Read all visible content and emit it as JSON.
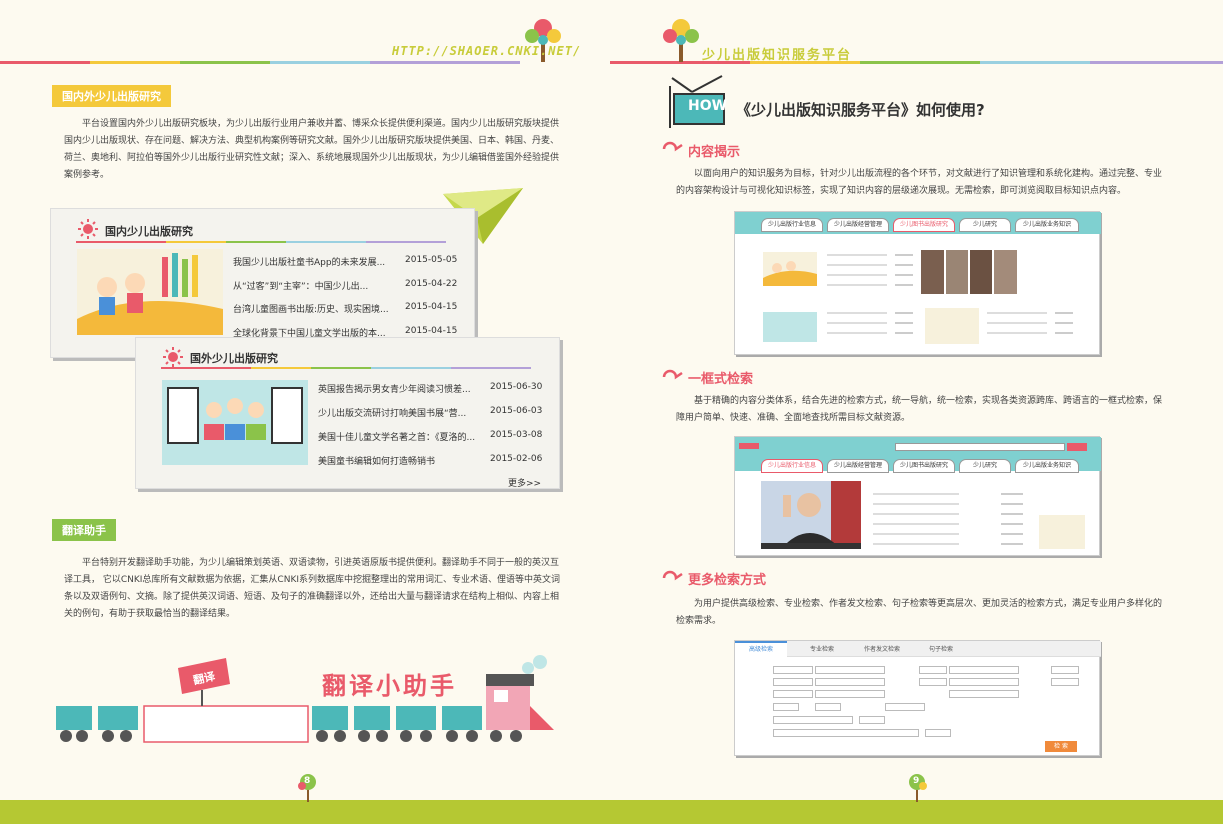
{
  "header": {
    "url": "HTTP://SHAOER.CNKI.NET/",
    "brand": "少儿出版知识服务平台"
  },
  "left": {
    "section1": {
      "label": "国内外少儿出版研究",
      "paragraph": "平台设置国内外少儿出版研究板块，为少儿出版行业用户兼收并蓄、博采众长提供便利渠道。国内少儿出版研究版块提供国内少儿出版现状、存在问题、解决方法、典型机构案例等研究文献。国外少儿出版研究版块提供美国、日本、韩国、丹麦、荷兰、奥地利、阿拉伯等国外少儿出版行业研究性文献；深入、系统地展现国外少儿出版现状，为少儿编辑借鉴国外经验提供案例参考。"
    },
    "domestic_card": {
      "title": "国内少儿出版研究",
      "items": [
        {
          "title": "我国少儿出版社童书App的未来发展...",
          "date": "2015-05-05"
        },
        {
          "title": "从“过客”到“主宰”：中国少儿出...",
          "date": "2015-04-22"
        },
        {
          "title": "台湾儿童图画书出版:历史、现实困境...",
          "date": "2015-04-15"
        },
        {
          "title": "全球化背景下中国儿童文学出版的本...",
          "date": "2015-04-15"
        }
      ]
    },
    "foreign_card": {
      "title": "国外少儿出版研究",
      "items": [
        {
          "title": "英国报告揭示男女青少年阅读习惯差...",
          "date": "2015-06-30"
        },
        {
          "title": "少儿出版交流研讨打响美国书展“营...",
          "date": "2015-06-03"
        },
        {
          "title": "美国十佳儿童文学名著之首：《夏洛的...",
          "date": "2015-03-08"
        },
        {
          "title": "美国童书编辑如何打造畅销书",
          "date": "2015-02-06"
        }
      ],
      "more": "更多>>"
    },
    "section2": {
      "label": "翻译助手",
      "paragraph": "平台特别开发翻译助手功能，为少儿编辑策划英语、双语读物，引进英语原版书提供便利。翻译助手不同于一般的英汉互译工具， 它以CNKI总库所有文献数据为依据，汇集从CNKI系列数据库中挖掘整理出的常用词汇、专业术语、俚语等中英文词条以及双语例句、文摘。除了提供英汉词语、短语、及句子的准确翻译以外，还给出大量与翻译请求在结构上相似、内容上相关的例句，有助于获取最恰当的翻译结果。"
    },
    "train": {
      "sign": "翻译",
      "art_title": "翻译小助手"
    },
    "page_number": "8"
  },
  "right": {
    "how_badge": "HOW",
    "how_title": "《少儿出版知识服务平台》如何使用?",
    "s1": {
      "heading": "内容揭示",
      "paragraph": "以面向用户的知识服务为目标，针对少儿出版流程的各个环节，对文献进行了知识管理和系统化建构。通过完整、专业的内容架构设计与可视化知识标签，实现了知识内容的层级递次展现。无需检索，即可浏览阅取目标知识点内容。",
      "tabs": [
        "少儿出版行业信息",
        "少儿出版经营管理",
        "少儿图书出版研究",
        "少儿研究",
        "少儿出版业务知识"
      ]
    },
    "s2": {
      "heading": "一框式检索",
      "paragraph": "基于精确的内容分类体系，结合先进的检索方式，统一导航，统一检索，实现各类资源跨库、跨语言的一框式检索，保障用户简单、快速、准确、全面地查找所需目标文献资源。",
      "tabs": [
        "少儿出版行业信息",
        "少儿出版经营管理",
        "少儿图书出版研究",
        "少儿研究",
        "少儿出版业务知识"
      ]
    },
    "s3": {
      "heading": "更多检索方式",
      "paragraph": "为用户提供高级检索、专业检索、作者发文检索、句子检索等更高层次、更加灵活的检索方式，满足专业用户多样化的检索需求。",
      "tabs": [
        "高级检索",
        "专业检索",
        "作者发文检索",
        "句子检索"
      ],
      "search_button": "检 索"
    },
    "page_number": "9"
  },
  "colors": {
    "accent_yellow": "#f4c93b",
    "accent_green": "#8bc34a",
    "accent_pink": "#e95a6a",
    "teal": "#4cb8b8",
    "footer_green": "#b5c833"
  }
}
